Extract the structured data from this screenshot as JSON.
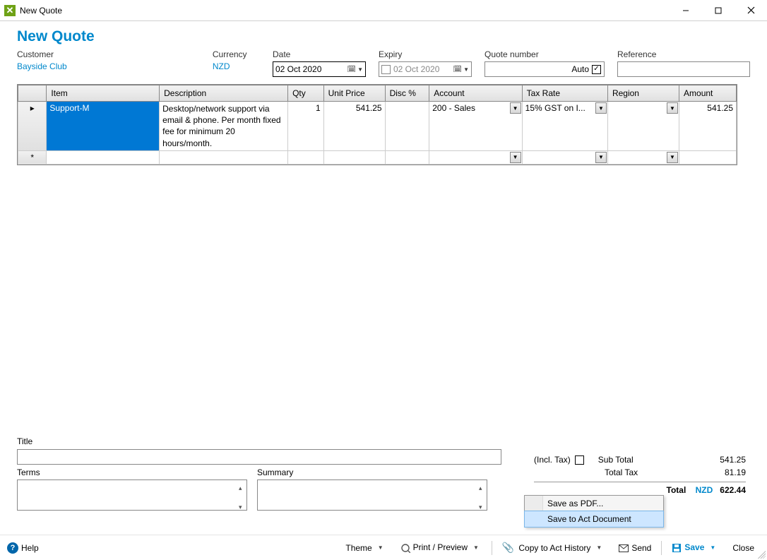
{
  "window": {
    "title": "New Quote"
  },
  "header": {
    "page_title": "New Quote"
  },
  "fields": {
    "customer_label": "Customer",
    "customer_value": "Bayside Club",
    "currency_label": "Currency",
    "currency_value": "NZD",
    "date_label": "Date",
    "date_value": "02  Oct  2020",
    "expiry_label": "Expiry",
    "expiry_value": "02  Oct  2020",
    "quote_number_label": "Quote number",
    "quote_number_auto": "Auto",
    "reference_label": "Reference",
    "reference_value": ""
  },
  "grid": {
    "headers": {
      "item": "Item",
      "description": "Description",
      "qty": "Qty",
      "unit_price": "Unit Price",
      "disc": "Disc %",
      "account": "Account",
      "tax_rate": "Tax Rate",
      "region": "Region",
      "amount": "Amount"
    },
    "rows": [
      {
        "item": "Support-M",
        "description": "Desktop/network support via email & phone.\nPer month fixed fee for minimum 20 hours/month.",
        "qty": "1",
        "unit_price": "541.25",
        "disc": "",
        "account": "200 - Sales",
        "tax_rate": "15% GST on I...",
        "region": "",
        "amount": "541.25"
      }
    ]
  },
  "lower": {
    "title_label": "Title",
    "title_value": "",
    "terms_label": "Terms",
    "terms_value": "",
    "summary_label": "Summary",
    "summary_value": ""
  },
  "totals": {
    "incl_tax_label": "(Incl. Tax)",
    "sub_total_label": "Sub Total",
    "sub_total": "541.25",
    "total_tax_label": "Total Tax",
    "total_tax": "81.19",
    "total_label": "Total",
    "currency": "NZD",
    "total": "622.44"
  },
  "popup": {
    "items": [
      {
        "label": "Save as PDF..."
      },
      {
        "label": "Save to Act Document"
      }
    ]
  },
  "footer": {
    "help": "Help",
    "theme": "Theme",
    "print_preview": "Print / Preview",
    "copy_act": "Copy to Act History",
    "send": "Send",
    "save": "Save",
    "close": "Close"
  }
}
